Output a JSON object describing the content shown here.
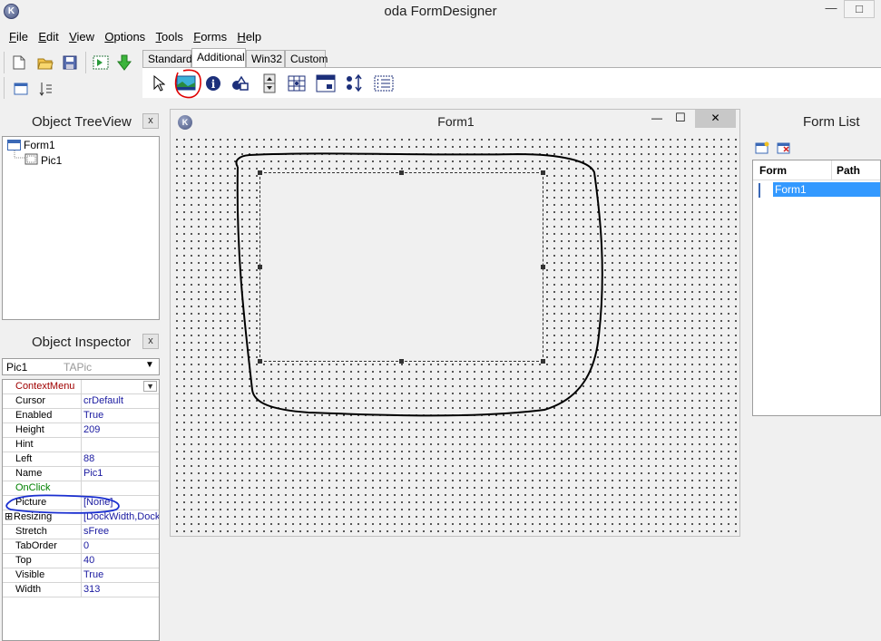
{
  "window": {
    "title": "oda FormDesigner",
    "app_icon_letter": "K"
  },
  "menu": [
    {
      "accel": "F",
      "rest": "ile"
    },
    {
      "accel": "E",
      "rest": "dit"
    },
    {
      "accel": "V",
      "rest": "iew"
    },
    {
      "accel": "O",
      "rest": "ptions"
    },
    {
      "accel": "T",
      "rest": "ools"
    },
    {
      "accel": "F",
      "rest": "orms"
    },
    {
      "accel": "H",
      "rest": "elp"
    }
  ],
  "palette": {
    "tabs": [
      "Standard",
      "Additional",
      "Win32",
      "Custom"
    ],
    "active_tab": "Additional"
  },
  "tree_view": {
    "title": "Object TreeView",
    "close_label": "x",
    "nodes": [
      {
        "label": "Form1"
      },
      {
        "label": "Pic1"
      }
    ]
  },
  "inspector": {
    "title": "Object Inspector",
    "close_label": "x",
    "object_name": "Pic1",
    "object_class": "TAPic",
    "properties": [
      {
        "name": "ContextMenu",
        "value": ""
      },
      {
        "name": "Cursor",
        "value": "crDefault"
      },
      {
        "name": "Enabled",
        "value": "True"
      },
      {
        "name": "Height",
        "value": "209"
      },
      {
        "name": "Hint",
        "value": ""
      },
      {
        "name": "Left",
        "value": "88"
      },
      {
        "name": "Name",
        "value": "Pic1"
      },
      {
        "name": "OnClick",
        "value": ""
      },
      {
        "name": "Picture",
        "value": "[None]"
      },
      {
        "name": "Resizing",
        "value": "[DockWidth,DockHeight]"
      },
      {
        "name": "Stretch",
        "value": "sFree"
      },
      {
        "name": "TabOrder",
        "value": "0"
      },
      {
        "name": "Top",
        "value": "40"
      },
      {
        "name": "Visible",
        "value": "True"
      },
      {
        "name": "Width",
        "value": "313"
      }
    ]
  },
  "form_window": {
    "title": "Form1",
    "icon_letter": "K",
    "minimize": "—",
    "maximize": "☐",
    "close": "✕"
  },
  "form_list": {
    "title": "Form List",
    "columns": [
      "Form",
      "Path"
    ],
    "rows": [
      {
        "form": "Form1",
        "path": ""
      }
    ]
  },
  "colors": {
    "selection": "#3399ff",
    "event_green": "#008000",
    "context_red": "#a00000",
    "annotation_red": "#e00000",
    "annotation_blue": "#1a2fd0"
  }
}
